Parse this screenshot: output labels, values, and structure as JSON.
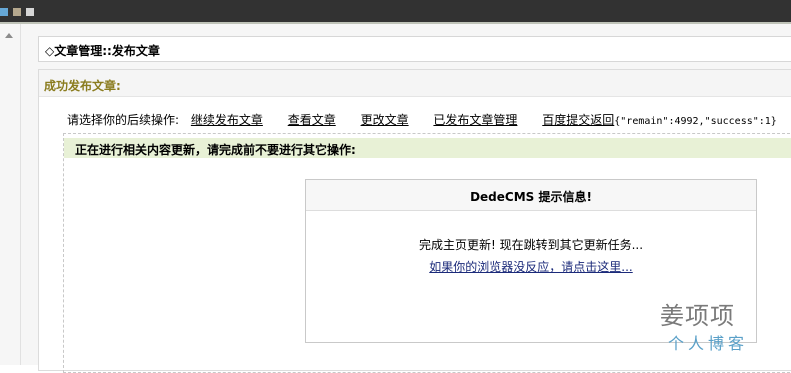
{
  "title": "◇文章管理::发布文章",
  "panel_heading": "成功发布文章:",
  "operations": {
    "prompt": "请选择你的后续操作:",
    "links": [
      "继续发布文章",
      "查看文章",
      "更改文章",
      "已发布文章管理",
      "百度提交返回"
    ],
    "submit_result": "{\"remain\":4992,\"success\":1}"
  },
  "notice": "正在进行相关内容更新，请完成前不要进行其它操作:",
  "message_box": {
    "header": "DedeCMS 提示信息!",
    "line1": "完成主页更新! 现在跳转到其它更新任务...",
    "link": "如果你的浏览器没反应，请点击这里..."
  },
  "watermark": {
    "line1": "姜项项",
    "line2": "个人博客"
  },
  "colors": {
    "topbar": "#323232",
    "heading": "#8a7c1e",
    "notice_bg": "#e8f1d6",
    "link": "#1b2a7a"
  }
}
